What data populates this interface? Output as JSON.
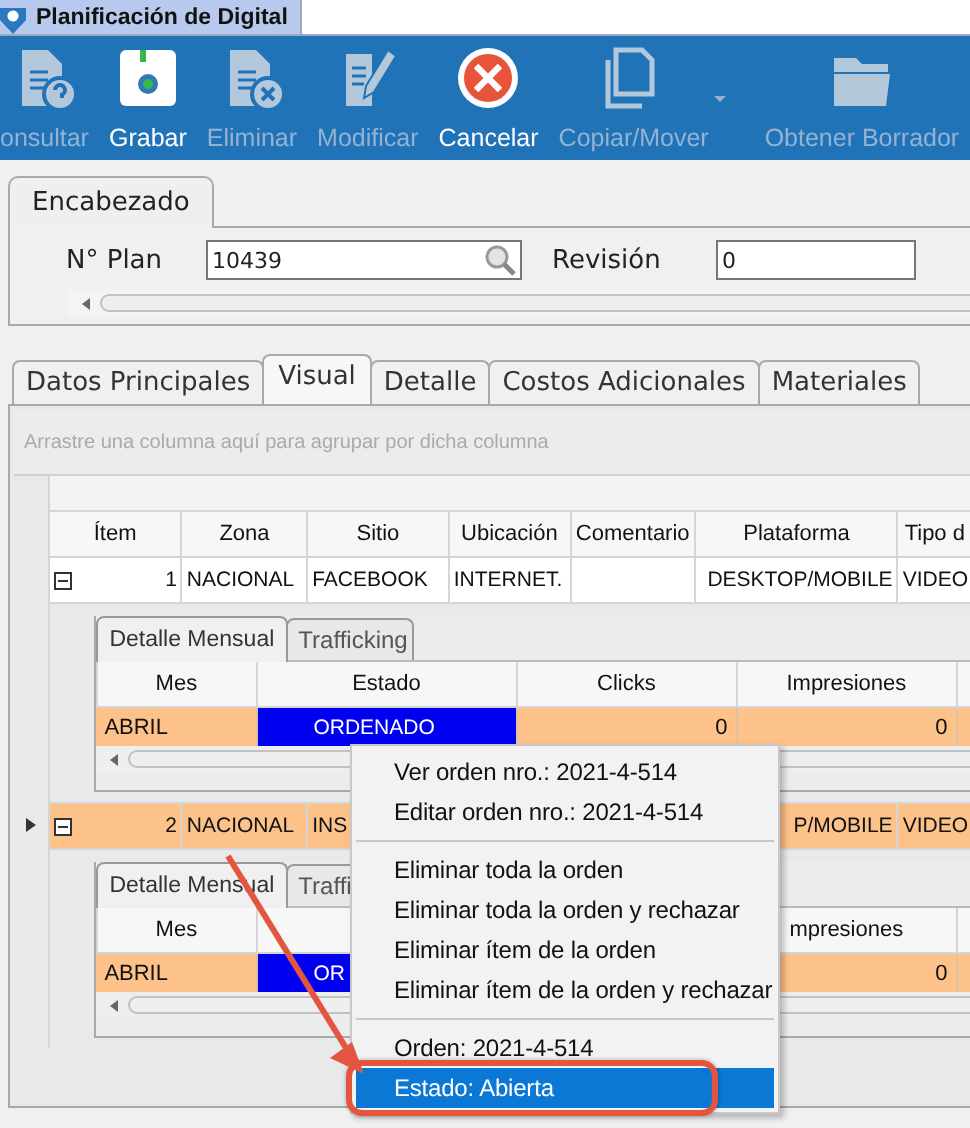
{
  "window": {
    "title": "Planificación de Digital"
  },
  "toolbar": [
    {
      "label": "onsultar",
      "disabled": true,
      "dropdown": false
    },
    {
      "label": "Grabar",
      "disabled": false,
      "dropdown": false
    },
    {
      "label": "Eliminar",
      "disabled": true,
      "dropdown": false
    },
    {
      "label": "Modificar",
      "disabled": true,
      "dropdown": false
    },
    {
      "label": "Cancelar",
      "disabled": false,
      "dropdown": false
    },
    {
      "label": "Copiar/Mover",
      "disabled": true,
      "dropdown": true
    },
    {
      "label": "Obtener Borrador",
      "disabled": true,
      "dropdown": false
    }
  ],
  "header_group": {
    "tab": "Encabezado",
    "fields": [
      {
        "label": "N° Plan",
        "value": "10439",
        "search": true
      },
      {
        "label": "Revisión",
        "value": "0",
        "search": false
      }
    ]
  },
  "tabs": [
    {
      "label": "Datos Principales",
      "selected": false
    },
    {
      "label": "Visual",
      "selected": true
    },
    {
      "label": "Detalle",
      "selected": false
    },
    {
      "label": "Costos Adicionales",
      "selected": false
    },
    {
      "label": "Materiales",
      "selected": false
    }
  ],
  "grid": {
    "group_hint": "Arrastre una columna aquí para agrupar por dicha columna",
    "columns": [
      "Ítem",
      "Zona",
      "Sitio",
      "Ubicación",
      "Comentario",
      "Plataforma",
      "Tipo d"
    ],
    "rows": [
      {
        "current": false,
        "selected": false,
        "expanded": true,
        "cells": [
          "1",
          "NACIONAL",
          "FACEBOOK",
          "INTERNET.",
          null,
          "DESKTOP/MOBILE",
          "VIDEO"
        ],
        "detail": {
          "tabs": [
            {
              "label": "Detalle Mensual",
              "selected": true
            },
            {
              "label": "Trafficking",
              "selected": false
            }
          ],
          "columns": [
            "Mes",
            "Estado",
            "Clicks",
            "Impresiones"
          ],
          "rows": [
            {
              "selected": true,
              "cells": [
                {
                  "text": "ABRIL",
                  "selected": false
                },
                {
                  "text": "ORDENADO",
                  "selected": true
                },
                {
                  "text": "0",
                  "selected": false
                },
                {
                  "text": "0",
                  "selected": false
                }
              ]
            }
          ]
        }
      },
      {
        "current": true,
        "selected": true,
        "expanded": true,
        "cells": [
          "2",
          "NACIONAL",
          "INS",
          null,
          null,
          "P/MOBILE",
          "VIDEO"
        ],
        "detail": {
          "tabs": [
            {
              "label": "Detalle Mensual",
              "selected": true
            },
            {
              "label": "Traffi",
              "selected": false
            }
          ],
          "columns": [
            "Mes",
            null,
            null,
            "mpresiones"
          ],
          "rows": [
            {
              "selected": true,
              "cells": [
                {
                  "text": "ABRIL",
                  "selected": false
                },
                {
                  "text": "OR",
                  "selected": true
                },
                null,
                {
                  "text": "0",
                  "selected": false
                }
              ]
            }
          ]
        }
      }
    ]
  },
  "context_menu": {
    "items": [
      {
        "kind": "item",
        "label": "Ver orden nro.: 2021-4-514",
        "selected": false
      },
      {
        "kind": "item",
        "label": "Editar orden nro.: 2021-4-514",
        "selected": false
      },
      {
        "kind": "separator"
      },
      {
        "kind": "item",
        "label": "Eliminar toda la orden",
        "selected": false
      },
      {
        "kind": "item",
        "label": "Eliminar toda la orden y rechazar",
        "selected": false
      },
      {
        "kind": "item",
        "label": "Eliminar ítem de la orden",
        "selected": false
      },
      {
        "kind": "item",
        "label": "Eliminar ítem de la orden y rechazar",
        "selected": false
      },
      {
        "kind": "separator"
      },
      {
        "kind": "item",
        "label": "Orden: 2021-4-514",
        "selected": false
      },
      {
        "kind": "item",
        "label": "Estado: Abierta",
        "selected": true
      }
    ]
  },
  "callout": {
    "color": "#e2553f"
  }
}
